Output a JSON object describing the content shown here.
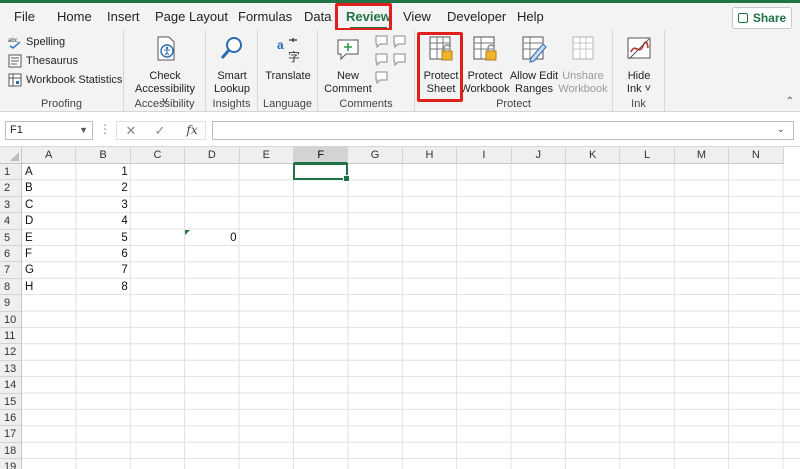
{
  "menu": {
    "tabs": [
      "File",
      "Home",
      "Insert",
      "Page Layout",
      "Formulas",
      "Data",
      "Review",
      "View",
      "Developer",
      "Help"
    ],
    "active_tab": "Review",
    "share_label": "Share"
  },
  "ribbon": {
    "proofing": {
      "label": "Proofing",
      "spelling": "Spelling",
      "spelling_badge": "abc",
      "thesaurus": "Thesaurus",
      "workbook_statistics": "Workbook Statistics"
    },
    "accessibility": {
      "label": "Accessibility",
      "check_line1": "Check",
      "check_line2": "Accessibility ˅"
    },
    "insights": {
      "label": "Insights",
      "smart_line1": "Smart",
      "smart_line2": "Lookup"
    },
    "language": {
      "label": "Language",
      "translate": "Translate"
    },
    "comments": {
      "label": "Comments",
      "new_line1": "New",
      "new_line2": "Comment"
    },
    "protect": {
      "label": "Protect",
      "protect_sheet_line1": "Protect",
      "protect_sheet_line2": "Sheet",
      "protect_workbook_line1": "Protect",
      "protect_workbook_line2": "Workbook",
      "allow_edit_line1": "Allow Edit",
      "allow_edit_line2": "Ranges",
      "unshare_line1": "Unshare",
      "unshare_line2": "Workbook"
    },
    "ink": {
      "label": "Ink",
      "hide_line1": "Hide",
      "hide_line2": "Ink ˅"
    }
  },
  "formula_bar": {
    "name_box": "F1",
    "fx": "fx",
    "cancel": "✕",
    "enter": "✓",
    "formula": ""
  },
  "sheet": {
    "columns": [
      "A",
      "B",
      "C",
      "D",
      "E",
      "F",
      "G",
      "H",
      "I",
      "J",
      "K",
      "L",
      "M",
      "N"
    ],
    "selected_column": "F",
    "selected_cell": "F1",
    "rows": [
      "1",
      "2",
      "3",
      "4",
      "5",
      "6",
      "7",
      "8",
      "9",
      "10",
      "11",
      "12",
      "13",
      "14",
      "15",
      "16",
      "17",
      "18",
      "19"
    ],
    "col_a": [
      "A",
      "B",
      "C",
      "D",
      "E",
      "F",
      "G",
      "H"
    ],
    "col_b": [
      "1",
      "2",
      "3",
      "4",
      "5",
      "6",
      "7",
      "8"
    ],
    "d5": "0"
  },
  "colors": {
    "accent": "#217346",
    "highlight": "#e0201c"
  }
}
